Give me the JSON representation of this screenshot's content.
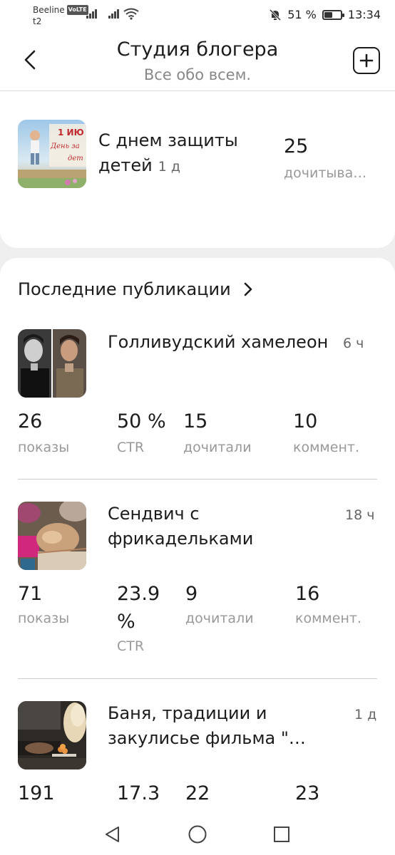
{
  "status_bar": {
    "carrier": "Beeline",
    "volte": "VoLTE",
    "carrier2": "t2",
    "battery_percent": "51 %",
    "battery_level": 0.51,
    "time": "13:34"
  },
  "header": {
    "title": "Студия блогера",
    "subtitle": "Все обо всем."
  },
  "top_publication": {
    "title": "С днем защиты детей",
    "age": "1 д",
    "reads_value": "25",
    "reads_label": "дочитыва…",
    "thumb_text_1": "1 ИЮ",
    "thumb_text_2": "День за",
    "thumb_text_3": "дет"
  },
  "recent": {
    "heading": "Последние публикации",
    "items": [
      {
        "title": "Голливудский хамелеон",
        "age": "6 ч",
        "stats": [
          {
            "value": "26",
            "label": "показы"
          },
          {
            "value": "50 %",
            "label": "CTR"
          },
          {
            "value": "15",
            "label": "дочитали"
          },
          {
            "value": "10",
            "label": "коммент."
          }
        ]
      },
      {
        "title_line1": "Сендвич с",
        "title_line2": "фрикадельками",
        "age": "18 ч",
        "stats": [
          {
            "value": "71",
            "label": "показы"
          },
          {
            "value_line1": "23.9",
            "value_line2": "%",
            "label": "CTR"
          },
          {
            "value": "9",
            "label": "дочитали"
          },
          {
            "value": "16",
            "label": "коммент."
          }
        ]
      },
      {
        "title_line1": "Баня, традиции и",
        "title_line2": "закулисье фильма \"…",
        "age": "1 д",
        "stats": [
          {
            "value": "191"
          },
          {
            "value": "17.3"
          },
          {
            "value": "22"
          },
          {
            "value": "23"
          }
        ]
      }
    ]
  },
  "icons": {
    "back": "chevron-left-icon",
    "add": "plus-square-icon",
    "forward": "chevron-right-icon",
    "nav_back": "triangle-back-icon",
    "nav_home": "circle-home-icon",
    "nav_recent": "square-recent-icon"
  }
}
